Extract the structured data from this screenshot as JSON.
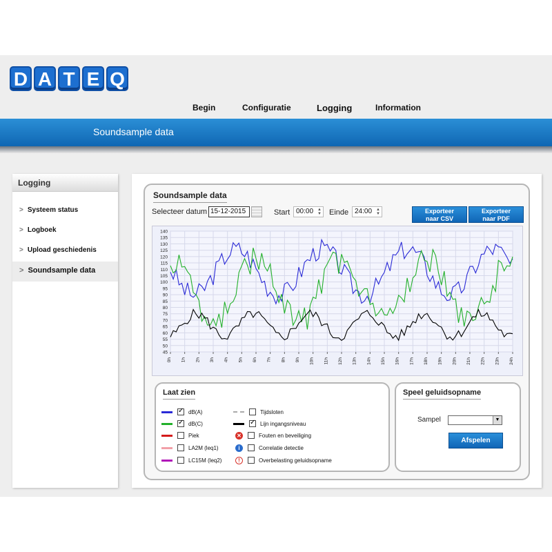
{
  "app": {
    "logo_letters": [
      "D",
      "A",
      "T",
      "E",
      "Q"
    ],
    "brand_color": "#1d6fd0"
  },
  "nav": {
    "items": [
      {
        "label": "Begin",
        "active": false
      },
      {
        "label": "Configuratie",
        "active": false
      },
      {
        "label": "Logging",
        "active": true
      },
      {
        "label": "Information",
        "active": false
      }
    ]
  },
  "banner": {
    "title": "Soundsample data"
  },
  "sidebar": {
    "title": "Logging",
    "items": [
      {
        "label": "Systeem status",
        "active": false
      },
      {
        "label": "Logboek",
        "active": false
      },
      {
        "label": "Upload geschiedenis",
        "active": false
      },
      {
        "label": "Soundsample data",
        "active": true
      }
    ]
  },
  "main": {
    "title": "Soundsample data",
    "date_label": "Selecteer datum",
    "date_value": "15-12-2015",
    "start_label": "Start",
    "start_value": "00:00",
    "end_label": "Einde",
    "end_value": "24:00",
    "export_csv_line1": "Exporteer",
    "export_csv_line2": "naar CSV",
    "export_pdf_line1": "Exporteer",
    "export_pdf_line2": "naar PDF"
  },
  "chart_data": {
    "type": "line",
    "y_ticks": [
      140,
      135,
      130,
      125,
      120,
      115,
      110,
      105,
      100,
      95,
      90,
      85,
      80,
      75,
      70,
      65,
      60,
      55,
      50,
      45
    ],
    "ylim": [
      45,
      140
    ],
    "x_ticks": [
      "0h",
      "1h",
      "2h",
      "3h",
      "4h",
      "5h",
      "6h",
      "7h",
      "8h",
      "9h",
      "10h",
      "11h",
      "12h",
      "13h",
      "14h",
      "15h",
      "16h",
      "17h",
      "18h",
      "19h",
      "20h",
      "21h",
      "22h",
      "23h",
      "24h"
    ],
    "xlim": [
      0,
      24
    ],
    "grid": true
  },
  "legend": {
    "title": "Laat zien",
    "left_items": [
      {
        "label": "dB(A)",
        "color": "#2a2ad6",
        "checked": true
      },
      {
        "label": "dB(C)",
        "color": "#22b02a",
        "checked": true
      },
      {
        "label": "Piek",
        "color": "#d41a1a",
        "checked": false
      },
      {
        "label": "LA2M (leq1)",
        "color": "#f2a0a8",
        "checked": false
      },
      {
        "label": "LC15M (leq2)",
        "color": "#b013b8",
        "checked": false
      }
    ],
    "right_items": [
      {
        "label": "Tijdsloten",
        "kind": "dashed",
        "checked": false
      },
      {
        "label": "Lijn ingangsniveau",
        "kind": "line",
        "color": "#000000",
        "checked": true
      },
      {
        "label": "Fouten en beveiliging",
        "kind": "error-icon",
        "checked": false
      },
      {
        "label": "Correlatie detectie",
        "kind": "info-icon",
        "checked": false
      },
      {
        "label": "Overbelasting geluidsopname",
        "kind": "warning-icon",
        "checked": false
      }
    ]
  },
  "player": {
    "title": "Speel geluidsopname",
    "sample_label": "Sampel",
    "sample_value": "",
    "play_label": "Afspelen"
  }
}
